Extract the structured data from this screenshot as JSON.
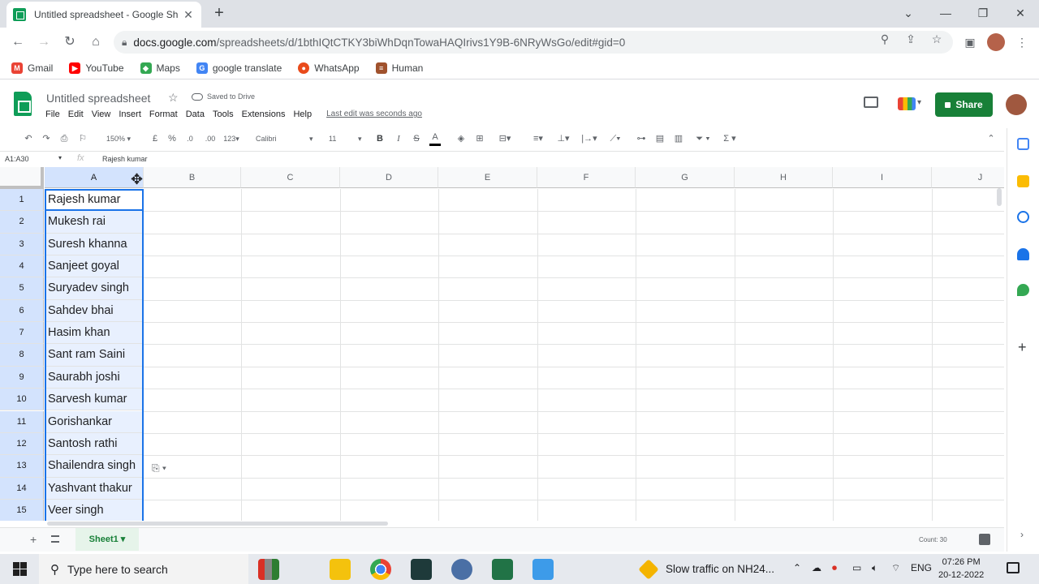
{
  "browser": {
    "tab_title": "Untitled spreadsheet - Google Sh",
    "tab_close": "✕",
    "new_tab": "+",
    "url_host": "docs.google.com",
    "url_path": "/spreadsheets/d/1bthIQtCTKY3biWhDqnTowaHAQIrivs1Y9B-6NRyWsGo/edit#gid=0",
    "bookmarks": [
      {
        "label": "Gmail",
        "color": "#ea4335",
        "glyph": "M"
      },
      {
        "label": "YouTube",
        "color": "#ff0000",
        "glyph": "▶"
      },
      {
        "label": "Maps",
        "color": "#34a853",
        "glyph": "◆"
      },
      {
        "label": "google translate",
        "color": "#4285f4",
        "glyph": "G"
      },
      {
        "label": "WhatsApp",
        "color": "#e94b1b",
        "glyph": "●"
      },
      {
        "label": "Human",
        "color": "#a0522d",
        "glyph": "≡"
      }
    ]
  },
  "sheets": {
    "doc_title": "Untitled spreadsheet",
    "saved_status": "Saved to Drive",
    "menu": [
      "File",
      "Edit",
      "View",
      "Insert",
      "Format",
      "Data",
      "Tools",
      "Extensions",
      "Help"
    ],
    "last_edit": "Last edit was seconds ago",
    "share_label": "Share",
    "toolbar": {
      "zoom": "150%",
      "currency": "£",
      "percent": "%",
      "dec_decrease": ".0",
      "dec_increase": ".00",
      "format_more": "123",
      "font": "Calibri",
      "font_size": "11",
      "bold": "B",
      "italic": "I",
      "strike": "S",
      "text_color": "A",
      "sum": "Σ"
    },
    "name_box": "A1:A30",
    "formula_value": "Rajesh kumar",
    "fx": "fx",
    "columns": [
      "A",
      "B",
      "C",
      "D",
      "E",
      "F",
      "G",
      "H",
      "I",
      "J"
    ],
    "rows": [
      {
        "num": "1",
        "a": "Rajesh kumar"
      },
      {
        "num": "2",
        "a": "Mukesh rai"
      },
      {
        "num": "3",
        "a": "Suresh khanna"
      },
      {
        "num": "4",
        "a": "Sanjeet goyal"
      },
      {
        "num": "5",
        "a": "Suryadev singh"
      },
      {
        "num": "6",
        "a": "Sahdev bhai"
      },
      {
        "num": "7",
        "a": "Hasim khan"
      },
      {
        "num": "8",
        "a": "Sant ram Saini"
      },
      {
        "num": "9",
        "a": "Saurabh joshi"
      },
      {
        "num": "10",
        "a": "Sarvesh kumar"
      },
      {
        "num": "11",
        "a": "Gorishankar"
      },
      {
        "num": "12",
        "a": "Santosh rathi"
      },
      {
        "num": "13",
        "a": "Shailendra singh"
      },
      {
        "num": "14",
        "a": "Yashvant thakur"
      },
      {
        "num": "15",
        "a": "Veer singh"
      }
    ],
    "sheet_tab": "Sheet1 ▾",
    "count_label": "Count: 30"
  },
  "taskbar": {
    "search_placeholder": "Type here to search",
    "traffic": "Slow traffic on NH24...",
    "lang": "ENG",
    "time": "07:26 PM",
    "date": "20-12-2022"
  }
}
